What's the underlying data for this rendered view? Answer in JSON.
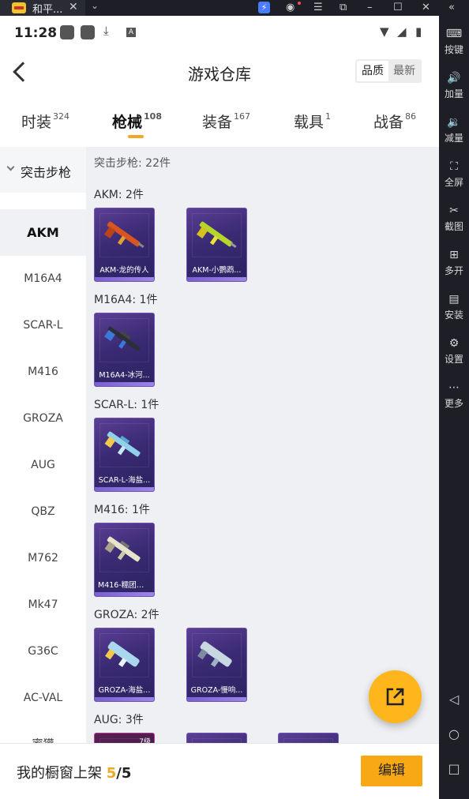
{
  "window": {
    "tab_title": "和平...",
    "close_glyph": "✕",
    "chev_glyph": "⌄",
    "controls": [
      "⚡",
      "◉",
      "☰",
      "⧉",
      "–",
      "☐",
      "✕",
      "«"
    ]
  },
  "status_bar": {
    "time": "11:28",
    "a_glyph": "A"
  },
  "header": {
    "title": "游戏仓库",
    "sort_quality": "品质",
    "sort_latest": "最新"
  },
  "tabs": [
    {
      "label": "时装",
      "count": "324"
    },
    {
      "label": "枪械",
      "count": "108"
    },
    {
      "label": "装备",
      "count": "167"
    },
    {
      "label": "载具",
      "count": "1"
    },
    {
      "label": "战备",
      "count": "86"
    }
  ],
  "sidebar": {
    "group": "突击步枪",
    "items": [
      "AKM",
      "M16A4",
      "SCAR-L",
      "M416",
      "GROZA",
      "AUG",
      "QBZ",
      "M762",
      "Mk47",
      "G36C",
      "AC-VAL",
      "蜜獾"
    ]
  },
  "content": {
    "crumb": "突击步枪: 22件",
    "sections": [
      {
        "title": "AKM: 2件",
        "items": [
          "AKM-龙的传人",
          "AKM-小鹦鹉..."
        ]
      },
      {
        "title": "M16A4: 1件",
        "items": [
          "M16A4-冰河..."
        ]
      },
      {
        "title": "SCAR-L: 1件",
        "items": [
          "SCAR-L-海盐..."
        ]
      },
      {
        "title": "M416: 1件",
        "items": [
          "M416-糯团青..."
        ]
      },
      {
        "title": "GROZA: 2件",
        "items": [
          "GROZA-海盐...",
          "GROZA-慢响..."
        ]
      },
      {
        "title": "AUG: 3件",
        "items": [
          "",
          "",
          ""
        ],
        "first_level": "7级"
      }
    ]
  },
  "bottom": {
    "label": "我的橱窗上架 ",
    "count": "5",
    "total": "/5",
    "edit": "编辑"
  },
  "toolbar": [
    {
      "icon": "⌨",
      "label": "按键"
    },
    {
      "icon": "🔊",
      "label": "加量"
    },
    {
      "icon": "🔉",
      "label": "减量"
    },
    {
      "icon": "⛶",
      "label": "全屏"
    },
    {
      "icon": "✂",
      "label": "截图"
    },
    {
      "icon": "⊞",
      "label": "多开"
    },
    {
      "icon": "▤",
      "label": "安装"
    },
    {
      "icon": "⚙",
      "label": "设置"
    },
    {
      "icon": "⋯",
      "label": "更多"
    }
  ],
  "nav": {
    "back": "◁",
    "home": "○",
    "recent": "□"
  },
  "colors": {
    "accent": "#f5a623",
    "fab": "#ffb51c",
    "card_top": "#5b3f95",
    "card_bottom": "#2a2360"
  }
}
